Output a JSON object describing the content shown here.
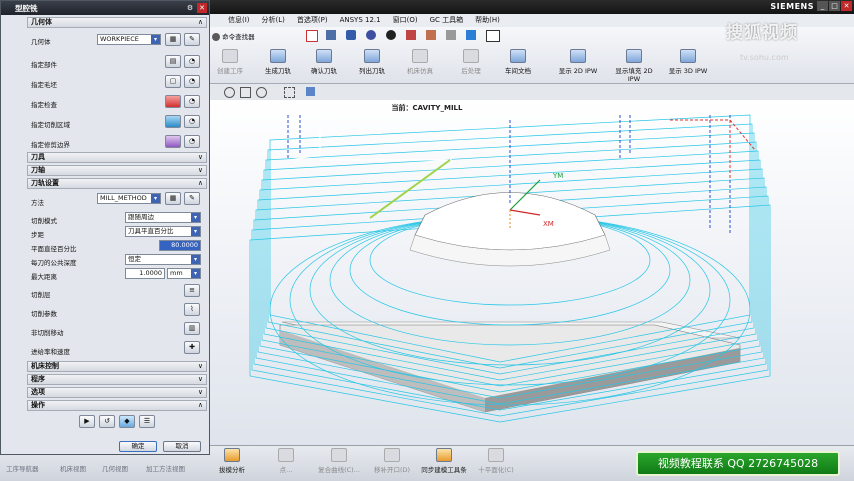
{
  "app": {
    "brand": "SIEMENS",
    "window_controls": [
      "_",
      "□",
      "✕"
    ]
  },
  "menu": {
    "items": [
      "信息(I)",
      "分析(L)",
      "首选项(P)",
      "ANSYS 12.1",
      "窗口(O)",
      "GC 工具箱",
      "帮助(H)"
    ]
  },
  "ribbon": {
    "command_finder": "命令查找器",
    "buttons": [
      {
        "label": "创建工序",
        "enabled": false
      },
      {
        "label": "生成刀轨",
        "enabled": true
      },
      {
        "label": "确认刀轨",
        "enabled": true
      },
      {
        "label": "列出刀轨",
        "enabled": true
      },
      {
        "label": "机床仿真",
        "enabled": false
      },
      {
        "label": "后处理",
        "enabled": false
      },
      {
        "label": "车间文档",
        "enabled": true
      },
      {
        "label": "显示 2D IPW",
        "enabled": true
      },
      {
        "label": "显示填充 2D IPW",
        "enabled": true
      },
      {
        "label": "显示 3D IPW",
        "enabled": true
      }
    ]
  },
  "viewport": {
    "title": "当前：CAVITY_MILL",
    "axis_y": "YM",
    "axis_x": "XM"
  },
  "watermark": {
    "line1": "搜狐视频",
    "line2": "tv.sohu.com"
  },
  "dialog": {
    "title": "型腔铣",
    "sections": {
      "geometry": "几何体",
      "tool": "刀具",
      "tool_axis": "刀轴",
      "path_settings": "刀轨设置",
      "machine_control": "机床控制",
      "program": "程序",
      "options": "选项",
      "actions": "操作"
    },
    "geometry": {
      "label": "几何体",
      "value": "WORKPIECE",
      "rows": [
        "指定部件",
        "指定毛坯",
        "指定检查",
        "指定切削区域",
        "指定修剪边界"
      ]
    },
    "path": {
      "method_label": "方法",
      "method_value": "MILL_METHOD",
      "cut_mode_label": "切削模式",
      "cut_mode_value": "跟随周边",
      "stepover_label": "步距",
      "stepover_value": "刀具平直百分比",
      "percent_label": "平面直径百分比",
      "percent_value": "80.0000",
      "depth_mode_label": "每刀的公共深度",
      "depth_mode_value": "恒定",
      "max_dist_label": "最大距离",
      "max_dist_value": "1.0000",
      "max_dist_unit": "mm",
      "items": [
        "切削层",
        "切削参数",
        "非切削移动",
        "进给率和速度"
      ]
    },
    "ok": "确定",
    "cancel": "取消"
  },
  "bottom": {
    "nav": [
      "工序导航器",
      "机床视图",
      "几何视图",
      "加工方法视图"
    ],
    "buttons": [
      {
        "label": "拔模分析",
        "enabled": true
      },
      {
        "label": "点...",
        "enabled": false
      },
      {
        "label": "复合曲线(C)...",
        "enabled": false
      },
      {
        "label": "移补开口(D)",
        "enabled": false
      },
      {
        "label": "同步建模工具条",
        "enabled": true
      },
      {
        "label": "十平面化(C)",
        "enabled": false
      }
    ],
    "contact": "视频教程联系  QQ 2726745028"
  },
  "colors": {
    "toolpath": "#27c6e6",
    "part": "#ffffff",
    "accent_dir": "#2b4fcf"
  }
}
